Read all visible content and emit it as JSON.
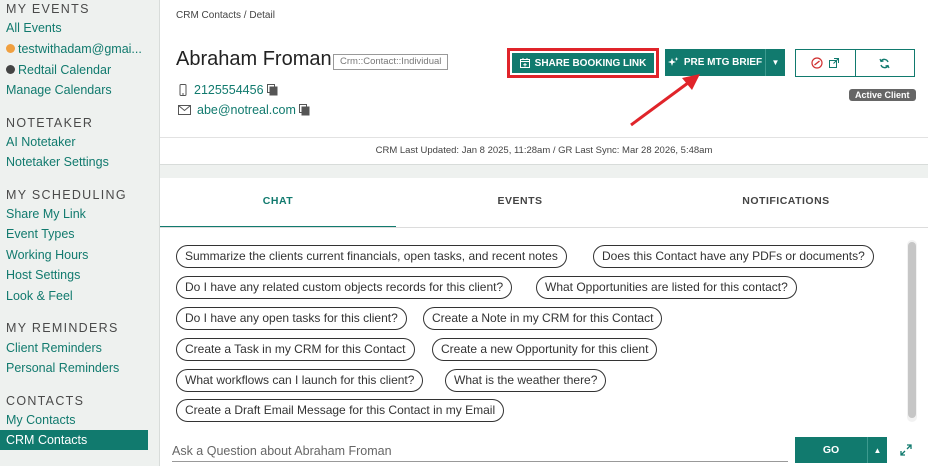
{
  "sidebar": {
    "events_header": "MY EVENTS",
    "all_events": "All Events",
    "calendar1": "testwithadam@gmai...",
    "calendar2": "Redtail Calendar",
    "manage_calendars": "Manage Calendars",
    "notetaker_header": "NOTETAKER",
    "ai_notetaker": "AI Notetaker",
    "notetaker_settings": "Notetaker Settings",
    "scheduling_header": "MY SCHEDULING",
    "share_my_link": "Share My Link",
    "event_types": "Event Types",
    "working_hours": "Working Hours",
    "host_settings": "Host Settings",
    "look_feel": "Look & Feel",
    "reminders_header": "MY REMINDERS",
    "client_reminders": "Client Reminders",
    "personal_reminders": "Personal Reminders",
    "contacts_header": "CONTACTS",
    "my_contacts": "My Contacts",
    "crm_contacts": "CRM Contacts"
  },
  "colors": {
    "accent": "#117a6e",
    "highlight": "#e0242a",
    "calendar1_dot": "#f0a040",
    "calendar2_dot": "#444444"
  },
  "contact": {
    "breadcrumb": "CRM Contacts / Detail",
    "name": "Abraham Froman",
    "type_badge": "Crm::Contact::Individual",
    "phone": "2125554456",
    "email": "abe@notreal.com",
    "status": "Active Client",
    "sync_text": "CRM Last Updated: Jan 8 2025, 11:28am / GR Last Sync: Mar 28 2026, 5:48am"
  },
  "actions": {
    "share_booking_link": "SHARE BOOKING LINK",
    "pre_mtg_brief": "PRE MTG BRIEF"
  },
  "tabs": {
    "chat": "CHAT",
    "events": "EVENTS",
    "notifications": "NOTIFICATIONS"
  },
  "suggestions": [
    "Summarize the clients current financials, open tasks, and recent notes",
    "Does this Contact have any PDFs or documents?",
    "Do I have any related custom objects records for this client?",
    "What Opportunities are listed for this contact?",
    "Do I have any open tasks for this client?",
    "Create a Note in my CRM for this Contact",
    "Create a Task in my CRM for this Contact",
    "Create a new Opportunity for this client",
    "What workflows can I launch for this client?",
    "What is the weather there?",
    "Create a Draft Email Message for this Contact in my Email"
  ],
  "chat": {
    "placeholder": "Ask a Question about Abraham Froman",
    "go_label": "GO"
  }
}
